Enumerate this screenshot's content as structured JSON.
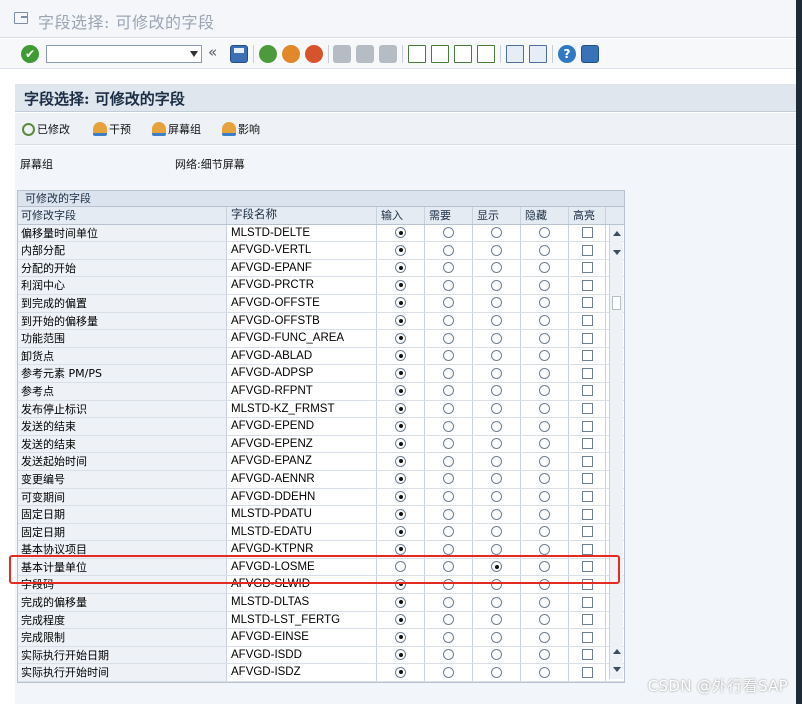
{
  "window": {
    "title": "字段选择: 可修改的字段"
  },
  "toolbar": {
    "command_value": "",
    "double_arrow": "«",
    "help": "?"
  },
  "screen": {
    "title": "字段选择: 可修改的字段",
    "buttons": [
      {
        "label": "已修改",
        "icon": "magnifier-icon"
      },
      {
        "label": "干预",
        "icon": "person-icon"
      },
      {
        "label": "屏幕组",
        "icon": "person-icon"
      },
      {
        "label": "影响",
        "icon": "person-icon"
      }
    ],
    "screen_group_label": "屏幕组",
    "screen_group_value": "网络:细节屏幕"
  },
  "table": {
    "title": "可修改的字段",
    "columns": [
      "可修改字段",
      "字段名称",
      "输入",
      "需要",
      "显示",
      "隐藏",
      "高亮"
    ],
    "rows": [
      {
        "desc": "偏移量时间单位",
        "field": "MLSTD-DELTE",
        "sel": "input",
        "hl": false
      },
      {
        "desc": "内部分配",
        "field": "AFVGD-VERTL",
        "sel": "input",
        "hl": false
      },
      {
        "desc": "分配的开始",
        "field": "AFVGD-EPANF",
        "sel": "input",
        "hl": false
      },
      {
        "desc": "利润中心",
        "field": "AFVGD-PRCTR",
        "sel": "input",
        "hl": false
      },
      {
        "desc": "到完成的偏置",
        "field": "AFVGD-OFFSTE",
        "sel": "input",
        "hl": false
      },
      {
        "desc": "到开始的偏移量",
        "field": "AFVGD-OFFSTB",
        "sel": "input",
        "hl": false
      },
      {
        "desc": "功能范围",
        "field": "AFVGD-FUNC_AREA",
        "sel": "input",
        "hl": false
      },
      {
        "desc": "卸货点",
        "field": "AFVGD-ABLAD",
        "sel": "input",
        "hl": false
      },
      {
        "desc": "参考元素 PM/PS",
        "field": "AFVGD-ADPSP",
        "sel": "input",
        "hl": false
      },
      {
        "desc": "参考点",
        "field": "AFVGD-RFPNT",
        "sel": "input",
        "hl": false
      },
      {
        "desc": "发布停止标识",
        "field": "MLSTD-KZ_FRMST",
        "sel": "input",
        "hl": false
      },
      {
        "desc": "发送的结束",
        "field": "AFVGD-EPEND",
        "sel": "input",
        "hl": false
      },
      {
        "desc": "发送的结束",
        "field": "AFVGD-EPENZ",
        "sel": "input",
        "hl": false
      },
      {
        "desc": "发送起始时间",
        "field": "AFVGD-EPANZ",
        "sel": "input",
        "hl": false
      },
      {
        "desc": "变更编号",
        "field": "AFVGD-AENNR",
        "sel": "input",
        "hl": false
      },
      {
        "desc": "可变期间",
        "field": "AFVGD-DDEHN",
        "sel": "input",
        "hl": false
      },
      {
        "desc": "固定日期",
        "field": "MLSTD-PDATU",
        "sel": "input",
        "hl": false
      },
      {
        "desc": "固定日期",
        "field": "MLSTD-EDATU",
        "sel": "input",
        "hl": false
      },
      {
        "desc": "基本协议项目",
        "field": "AFVGD-KTPNR",
        "sel": "input",
        "hl": false
      },
      {
        "desc": "基本计量单位",
        "field": "AFVGD-LOSME",
        "sel": "display",
        "hl": false
      },
      {
        "desc": "字段码",
        "field": "AFVGD-SLWID",
        "sel": "input",
        "hl": false
      },
      {
        "desc": "完成的偏移量",
        "field": "MLSTD-DLTAS",
        "sel": "input",
        "hl": false
      },
      {
        "desc": "完成程度",
        "field": "MLSTD-LST_FERTG",
        "sel": "input",
        "hl": false
      },
      {
        "desc": "完成限制",
        "field": "AFVGD-EINSE",
        "sel": "input",
        "hl": false
      },
      {
        "desc": "实际执行开始日期",
        "field": "AFVGD-ISDD",
        "sel": "input",
        "hl": false
      },
      {
        "desc": "实际执行开始时间",
        "field": "AFVGD-ISDZ",
        "sel": "input",
        "hl": false
      }
    ]
  },
  "watermark": "CSDN @外行看SAP",
  "colors": {
    "highlight_border": "#e52a22",
    "header_bg": "#dfe6ee"
  }
}
